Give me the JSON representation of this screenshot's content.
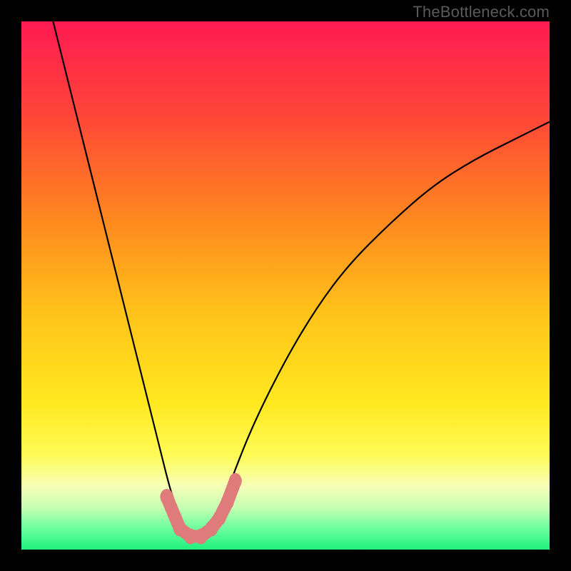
{
  "watermark": "TheBottleneck.com",
  "chart_data": {
    "type": "line",
    "title": "",
    "xlabel": "",
    "ylabel": "",
    "xlim": [
      0,
      100
    ],
    "ylim": [
      0,
      100
    ],
    "annotations": [
      {
        "text": "TheBottleneck.com",
        "position": "top-right"
      }
    ],
    "background_gradient": {
      "stops": [
        {
          "pos": 0.0,
          "color": "#ff1a52"
        },
        {
          "pos": 0.18,
          "color": "#ff4638"
        },
        {
          "pos": 0.38,
          "color": "#ff8a1f"
        },
        {
          "pos": 0.55,
          "color": "#ffc21a"
        },
        {
          "pos": 0.72,
          "color": "#ffe81e"
        },
        {
          "pos": 0.82,
          "color": "#fffb55"
        },
        {
          "pos": 0.88,
          "color": "#f7ffb7"
        },
        {
          "pos": 0.92,
          "color": "#c7ffb3"
        },
        {
          "pos": 0.96,
          "color": "#6cff9f"
        },
        {
          "pos": 1.0,
          "color": "#1ff07e"
        }
      ]
    },
    "series": [
      {
        "name": "bottleneck-curve-main",
        "color": "#000000",
        "x": [
          6,
          8,
          10,
          12,
          14,
          16,
          18,
          20,
          22,
          24,
          26,
          28,
          29,
          30,
          31,
          32,
          33,
          34,
          35,
          36,
          38,
          40,
          44,
          50,
          56,
          62,
          70,
          78,
          86,
          94,
          100
        ],
        "y": [
          100,
          92,
          84,
          76,
          68,
          60,
          52,
          44,
          36,
          28,
          20,
          12,
          9,
          6,
          4,
          3,
          2.5,
          2.5,
          3,
          4,
          8,
          14,
          24,
          36,
          46,
          54,
          62,
          69,
          74,
          78,
          81
        ]
      },
      {
        "name": "bottleneck-markers",
        "color": "#e07b7b",
        "type": "scatter",
        "x": [
          27.5,
          30,
          32,
          34,
          36,
          37.5,
          39,
          40.5
        ],
        "y": [
          10,
          4,
          2.5,
          2.5,
          4,
          6,
          9,
          13
        ]
      }
    ],
    "flat_bottom_segment": {
      "x_start": 30,
      "x_end": 36,
      "y": 2.5
    }
  }
}
